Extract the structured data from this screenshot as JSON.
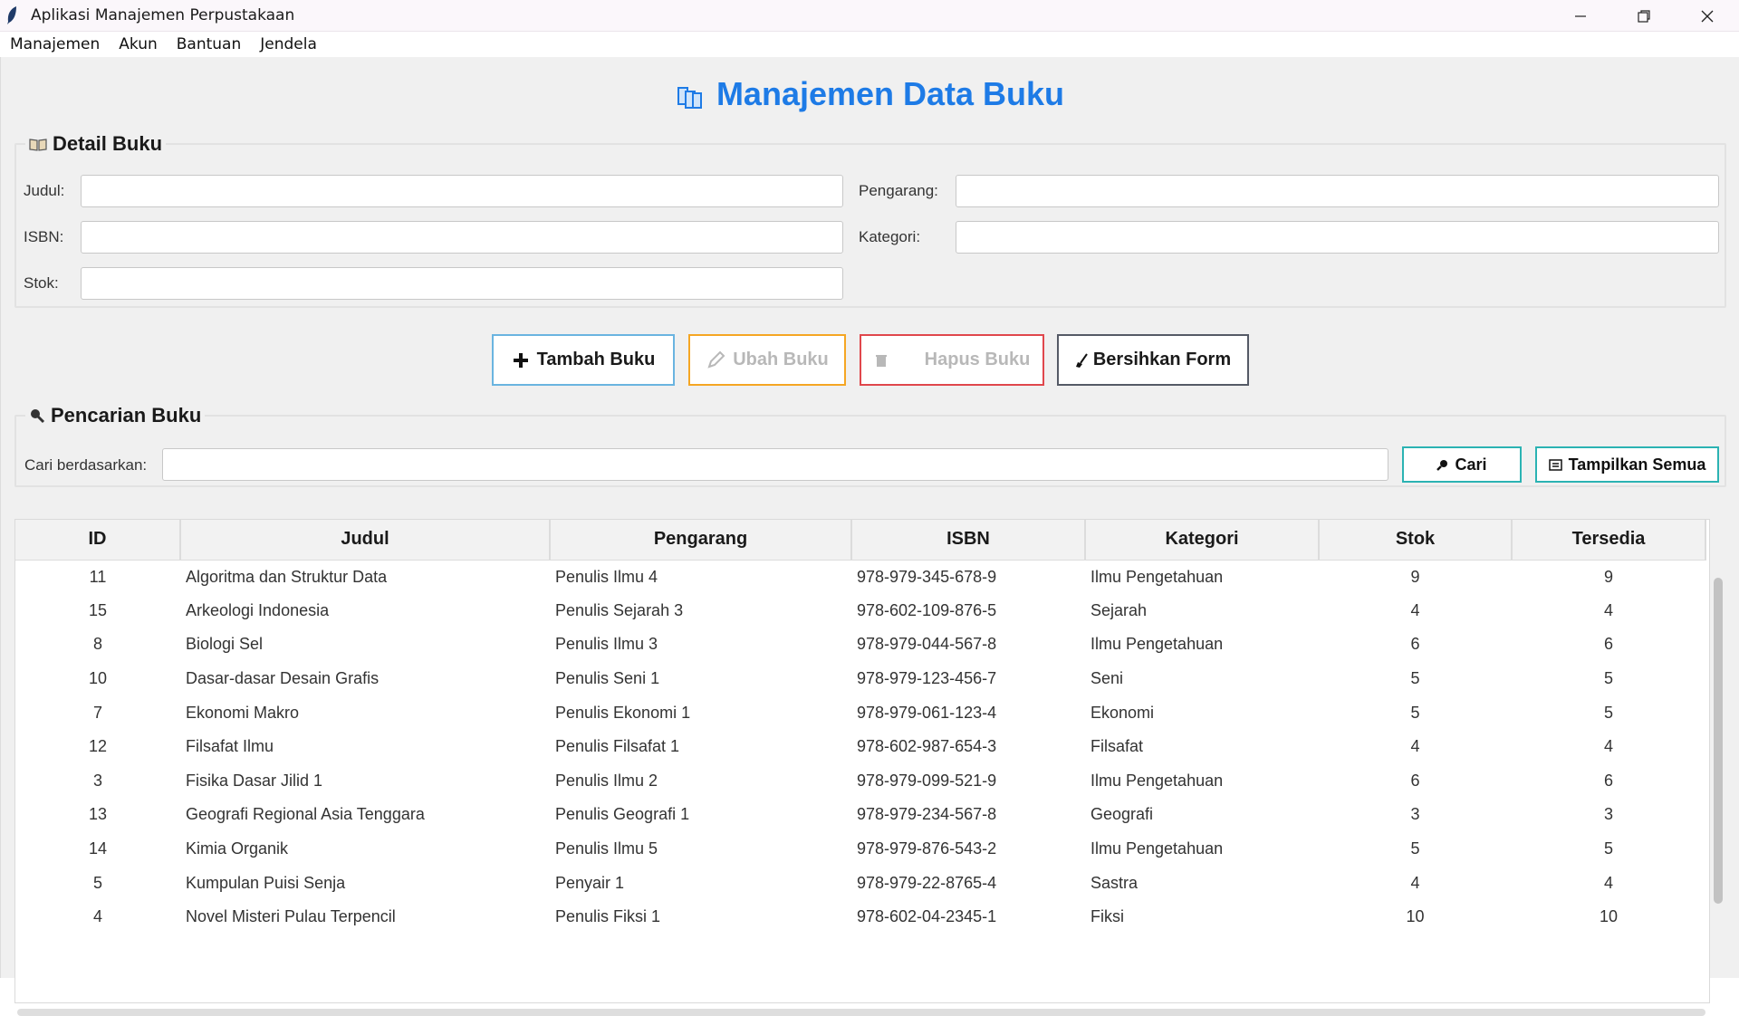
{
  "window": {
    "title": "Aplikasi Manajemen Perpustakaan",
    "icons": {
      "app": "feather-icon",
      "minimize": "minimize-icon",
      "maximize": "restore-icon",
      "close": "close-icon"
    }
  },
  "menu": [
    "Manajemen",
    "Akun",
    "Bantuan",
    "Jendela"
  ],
  "page_title": "Manajemen Data Buku",
  "detail": {
    "legend": "Detail Buku",
    "fields": {
      "judul": {
        "label": "Judul:",
        "value": ""
      },
      "pengarang": {
        "label": "Pengarang:",
        "value": ""
      },
      "isbn": {
        "label": "ISBN:",
        "value": ""
      },
      "kategori": {
        "label": "Kategori:",
        "value": ""
      },
      "stok": {
        "label": "Stok:",
        "value": ""
      }
    }
  },
  "actions": {
    "tambah": {
      "label": "Tambah Buku",
      "border": "#6ab4e0",
      "enabled": true
    },
    "ubah": {
      "label": "Ubah Buku",
      "border": "#f5a623",
      "enabled": false
    },
    "hapus": {
      "label": "Hapus Buku",
      "border": "#e0474c",
      "enabled": false
    },
    "bersihkan": {
      "label": "Bersihkan Form",
      "border": "#555a66",
      "enabled": true
    }
  },
  "search": {
    "legend": "Pencarian Buku",
    "label": "Cari berdasarkan:",
    "value": "",
    "cari_label": "Cari",
    "semua_label": "Tampilkan Semua"
  },
  "table": {
    "columns": [
      "ID",
      "Judul",
      "Pengarang",
      "ISBN",
      "Kategori",
      "Stok",
      "Tersedia"
    ],
    "rows": [
      [
        "11",
        "Algoritma dan Struktur Data",
        "Penulis Ilmu 4",
        "978-979-345-678-9",
        "Ilmu Pengetahuan",
        "9",
        "9"
      ],
      [
        "15",
        "Arkeologi Indonesia",
        "Penulis Sejarah 3",
        "978-602-109-876-5",
        "Sejarah",
        "4",
        "4"
      ],
      [
        "8",
        "Biologi Sel",
        "Penulis Ilmu 3",
        "978-979-044-567-8",
        "Ilmu Pengetahuan",
        "6",
        "6"
      ],
      [
        "10",
        "Dasar-dasar Desain Grafis",
        "Penulis Seni 1",
        "978-979-123-456-7",
        "Seni",
        "5",
        "5"
      ],
      [
        "7",
        "Ekonomi Makro",
        "Penulis Ekonomi 1",
        "978-979-061-123-4",
        "Ekonomi",
        "5",
        "5"
      ],
      [
        "12",
        "Filsafat Ilmu",
        "Penulis Filsafat 1",
        "978-602-987-654-3",
        "Filsafat",
        "4",
        "4"
      ],
      [
        "3",
        "Fisika Dasar Jilid 1",
        "Penulis Ilmu 2",
        "978-979-099-521-9",
        "Ilmu Pengetahuan",
        "6",
        "6"
      ],
      [
        "13",
        "Geografi Regional Asia Tenggara",
        "Penulis Geografi 1",
        "978-979-234-567-8",
        "Geografi",
        "3",
        "3"
      ],
      [
        "14",
        "Kimia Organik",
        "Penulis Ilmu 5",
        "978-979-876-543-2",
        "Ilmu Pengetahuan",
        "5",
        "5"
      ],
      [
        "5",
        "Kumpulan Puisi Senja",
        "Penyair 1",
        "978-979-22-8765-4",
        "Sastra",
        "4",
        "4"
      ],
      [
        "4",
        "Novel Misteri Pulau Terpencil",
        "Penulis Fiksi 1",
        "978-602-04-2345-1",
        "Fiksi",
        "10",
        "10"
      ]
    ]
  },
  "colors": {
    "accent": "#1e7be6",
    "search_border": "#2bb3b3"
  }
}
